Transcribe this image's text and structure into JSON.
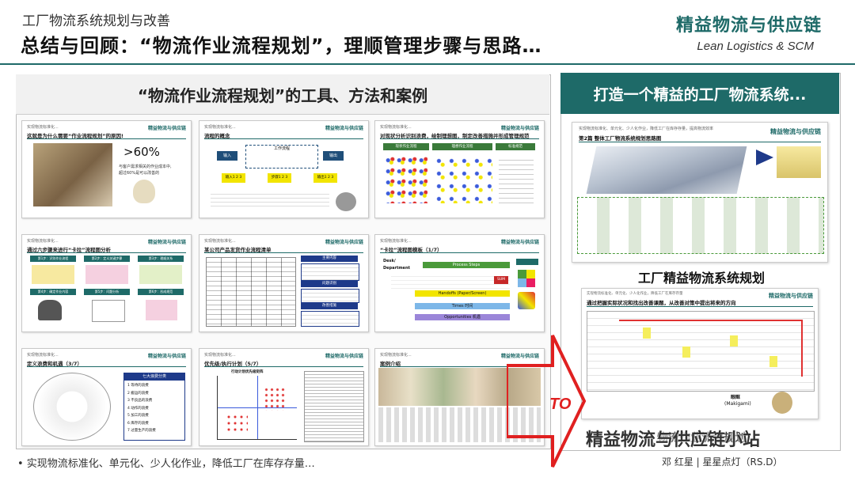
{
  "header": {
    "subtitle": "工厂物流系统规划与改善",
    "title": "总结与回顾：“物流作业流程规划”，理顺管理步骤与思路…",
    "brand_cn": "精益物流与供应链",
    "brand_en": "Lean Logistics & SCM"
  },
  "left_panel": {
    "heading": "“物流作业流程规划”的工具、方法和案例",
    "thumbs": [
      {
        "title": "这就是为什么需要“作业流程规划”的原因!",
        "big_number": ">60%",
        "note1": "与客户需求相关的作业成本中,",
        "note2": "超过60%是可以改善的"
      },
      {
        "title": "流程的概念",
        "chips": [
          "输入",
          "工作流程",
          "输出"
        ],
        "row2": [
          "输入1 2 3",
          "步骤1 2 3",
          "输出1 2 3"
        ]
      },
      {
        "title": "对现状分析识别浪费，绘制理想图，制定改善措施并形成管理规范",
        "tabs": [
          "现状作业流程",
          "理想作业流程",
          "标准规范"
        ]
      },
      {
        "title": "通过六步骤来进行“卡拉”流程图分析",
        "steps": [
          "第1步：识别作业流程",
          "第2步：定义关键步骤",
          "第3步：理顺关系",
          "第4步：确定作业内容",
          "第5步：问题分析",
          "第6步：形成规范"
        ]
      },
      {
        "title": "某公司产品发货作业流程清单",
        "labels": [
          "主要内容",
          "问题识别",
          "改善措施"
        ]
      },
      {
        "title": "“卡拉”流程图模板（1/7）",
        "rows": [
          "Desk/",
          "Department",
          "Process Steps",
          "Handoffs (Paper/Screen)",
          "Times 时间",
          "Opportunities 机遇"
        ],
        "sum": "SUM"
      },
      {
        "title": "定义浪费和机遇（3/7）",
        "list_title": "七大浪费分类",
        "list": [
          "1 等待的浪费",
          "2 搬运的浪费",
          "3 不良品的浪费",
          "4 动作的浪费",
          "5 加工的浪费",
          "6 库存的浪费",
          "7 过量生产的浪费"
        ]
      },
      {
        "title": "优先级/执行计划（5/7）",
        "chart_title": "行动计划优先级矩阵"
      },
      {
        "title": "案例介绍"
      }
    ]
  },
  "right_panel": {
    "heading": "打造一个精益的工厂物流系统...",
    "slide1_header": "实现物流标准化、单元化、少人化作业，降低工厂在库存存量，提高物流效率",
    "slide1_title": "第2篇 整体工厂物流系统规划思路图",
    "slide1_brand": "精益物流与供应链",
    "caption_mid": "工厂精益物流系统规划",
    "slide2_header": "实现物流标准化、单元化、少人化作业，降低工厂在库存存量",
    "slide2_title": "通过把握实际状况和找出改善课题，从改善对策中提出将来的方向",
    "slide2_brand": "精益物流与供应链",
    "mekigami_cn": "眼眶",
    "mekigami_en": "(Makigami)",
    "arrow_label": "TO",
    "bottom_caption": "物流作业流程规划"
  },
  "footer": {
    "left_note": "• 实现物流标准化、单元化、少人化作业，降低工厂在库存存量…",
    "author": "邓 红星 | 星星点灯（RS.D）",
    "watermark": "精益物流与供应链小站"
  },
  "colors": {
    "accent": "#1e6a68",
    "arrow": "#e02020",
    "highlight_yellow": "#f5ee5c",
    "band_blue": "#1e3a8a"
  }
}
